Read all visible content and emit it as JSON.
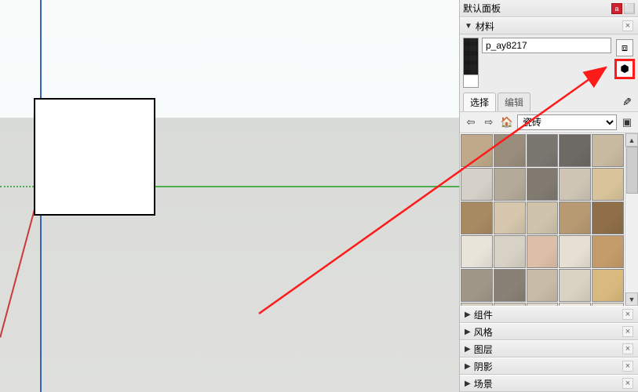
{
  "titlebar": {
    "title": "默认面板",
    "pin": "a",
    "close": "⬜"
  },
  "panels": {
    "materials": {
      "title": "材料",
      "expanded": true,
      "material_name": "p_ay8217",
      "tabs": {
        "select": "选择",
        "edit": "编辑"
      },
      "category": "瓷砖",
      "swatch_colors": [
        "#bfa98a",
        "#9a8d7c",
        "#7a7771",
        "#6d6a65",
        "#c8baa0",
        "#d6d1c8",
        "#b4aa9a",
        "#807a70",
        "#cec5b5",
        "#d8c39a",
        "#a88a62",
        "#d5c6ad",
        "#cfc3ac",
        "#b79a72",
        "#8f6f4a",
        "#e9e4da",
        "#d8d1c5",
        "#dcbfa8",
        "#e6e0d3",
        "#c49c6a",
        "#a09788",
        "#8a8176",
        "#c6bba6",
        "#d8d2c2",
        "#d9b97e",
        "#d6cfbf",
        "#d4cdbe",
        "#dedace",
        "#ece8dc",
        "#e8e3d4"
      ]
    },
    "collapsed": [
      {
        "title": "组件"
      },
      {
        "title": "风格"
      },
      {
        "title": "图层"
      },
      {
        "title": "阴影"
      },
      {
        "title": "场景"
      }
    ]
  },
  "icons": {
    "back": "⇦",
    "forward": "⇨",
    "home": "🏠",
    "detail": "▣",
    "eyedropper": "✎",
    "create_material": "⬢",
    "cube": "⧈",
    "expand": "▼",
    "collapse": "▶",
    "close": "×",
    "up": "▲",
    "down": "▼"
  }
}
